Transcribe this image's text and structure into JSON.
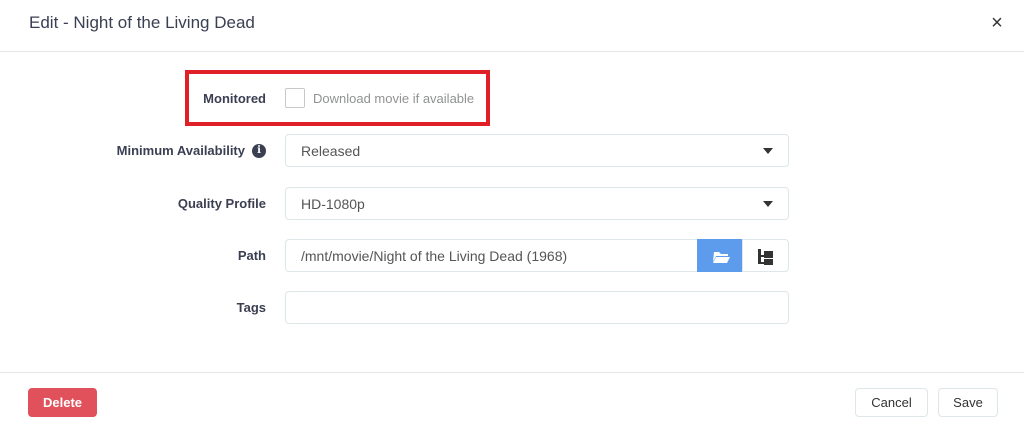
{
  "dialog": {
    "title": "Edit - Night of the Living Dead",
    "close_label": "×"
  },
  "form": {
    "monitored": {
      "label": "Monitored",
      "help_text": "Download movie if available",
      "checked": false
    },
    "minimum_availability": {
      "label": "Minimum Availability",
      "value": "Released"
    },
    "quality_profile": {
      "label": "Quality Profile",
      "value": "HD-1080p"
    },
    "path": {
      "label": "Path",
      "value": "/mnt/movie/Night of the Living Dead (1968)"
    },
    "tags": {
      "label": "Tags",
      "value": ""
    }
  },
  "footer": {
    "delete_label": "Delete",
    "cancel_label": "Cancel",
    "save_label": "Save"
  },
  "colors": {
    "delete": "#e0515b",
    "browse": "#5d9cec",
    "highlight": "#e02027"
  },
  "icons": {
    "close": "close-icon",
    "info": "info-icon",
    "browse": "folder-open-icon",
    "tree": "sitemap-icon",
    "select": "caret-down-icon"
  }
}
